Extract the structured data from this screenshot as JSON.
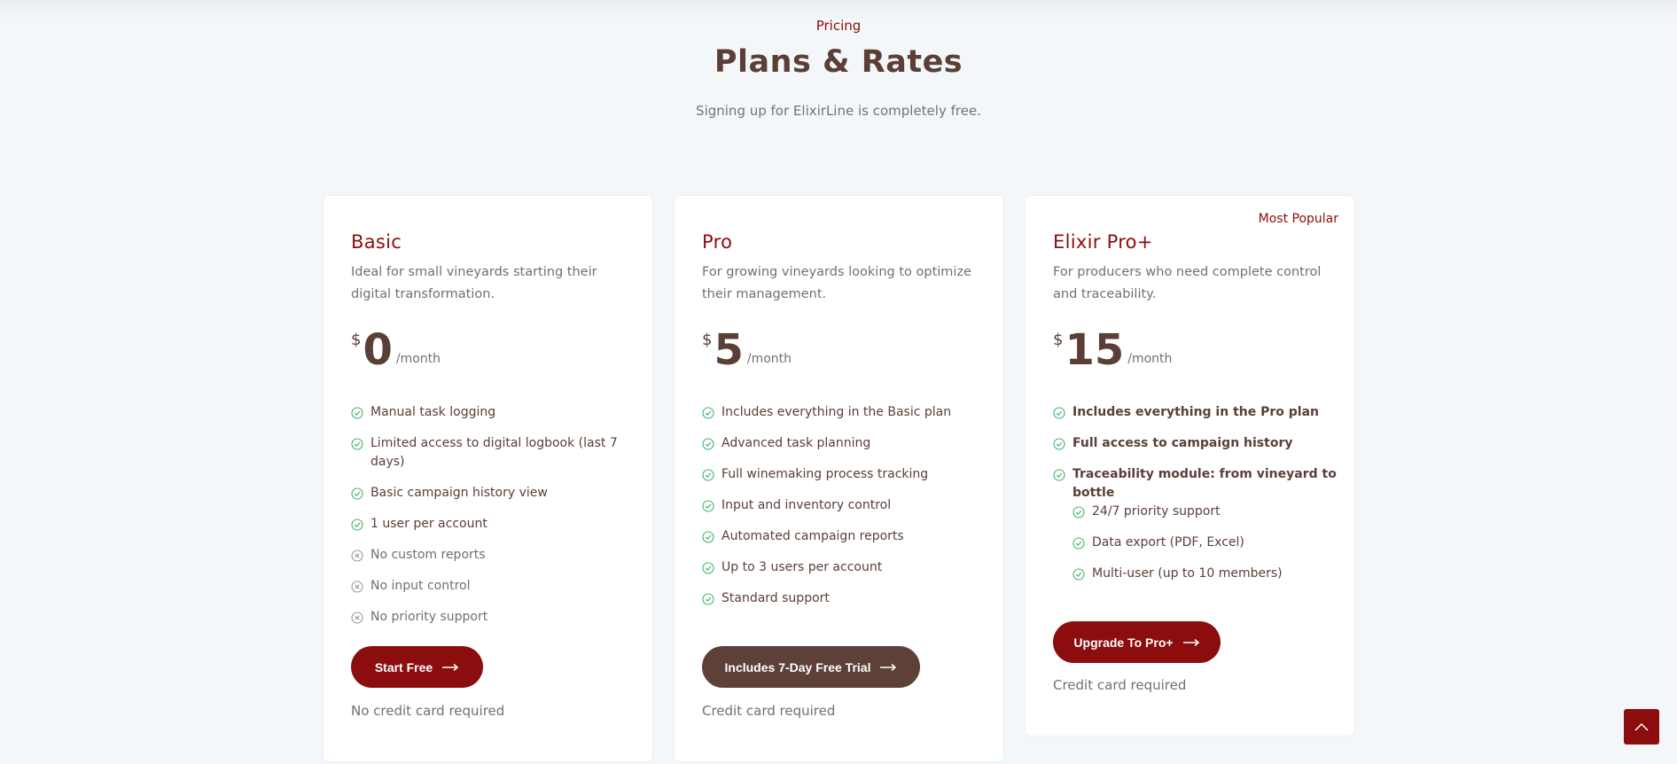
{
  "header": {
    "eyebrow": "Pricing",
    "title": "Plans & Rates",
    "subtitle": "Signing up for ElixirLine is completely free."
  },
  "colors": {
    "accent": "#8b0d0d",
    "brown": "#5d4037",
    "check": "#43b36b",
    "cross": "#9a9a9a"
  },
  "plans": [
    {
      "name": "Basic",
      "description": "Ideal for small vineyards starting their digital transformation.",
      "currency": "$",
      "amount": "0",
      "period": "/month",
      "features": [
        {
          "text": "Manual task logging",
          "icon": "check-icon"
        },
        {
          "text": "Limited access to digital logbook (last 7 days)",
          "icon": "check-icon"
        },
        {
          "text": "Basic campaign history view",
          "icon": "check-icon"
        },
        {
          "text": "1 user per account",
          "icon": "check-icon"
        },
        {
          "text": "No custom reports",
          "icon": "cross-icon"
        },
        {
          "text": "No input control",
          "icon": "cross-icon"
        },
        {
          "text": "No priority support",
          "icon": "cross-icon"
        }
      ],
      "button": "Start Free",
      "note": "No credit card required"
    },
    {
      "name": "Pro",
      "description": "For growing vineyards looking to optimize their management.",
      "currency": "$",
      "amount": "5",
      "period": "/month",
      "features": [
        {
          "text": "Includes everything in the Basic plan",
          "icon": "check-icon"
        },
        {
          "text": "Advanced task planning",
          "icon": "check-icon"
        },
        {
          "text": "Full winemaking process tracking",
          "icon": "check-icon"
        },
        {
          "text": "Input and inventory control",
          "icon": "check-icon"
        },
        {
          "text": "Automated campaign reports",
          "icon": "check-icon"
        },
        {
          "text": "Up to 3 users per account",
          "icon": "check-icon"
        },
        {
          "text": "Standard support",
          "icon": "check-icon"
        }
      ],
      "button": "Includes 7-Day Free Trial",
      "note": "Credit card required"
    },
    {
      "name": "Elixir Pro+",
      "badge": "Most Popular",
      "description": "For producers who need complete control and traceability.",
      "currency": "$",
      "amount": "15",
      "period": "/month",
      "features": [
        {
          "text": "Includes everything in the Pro plan",
          "icon": "check-icon"
        },
        {
          "text": "Full access to campaign history",
          "icon": "check-icon"
        },
        {
          "text": "Traceability module: from vineyard to bottle",
          "icon": "check-icon"
        },
        {
          "text": "24/7 priority support",
          "icon": "check-icon"
        },
        {
          "text": "Data export (PDF, Excel)",
          "icon": "check-icon"
        },
        {
          "text": "Multi-user (up to 10 members)",
          "icon": "check-icon"
        }
      ],
      "button": "Upgrade To Pro+",
      "note": "Credit card required"
    }
  ],
  "scroll_top_icon": "chevron-up-icon"
}
